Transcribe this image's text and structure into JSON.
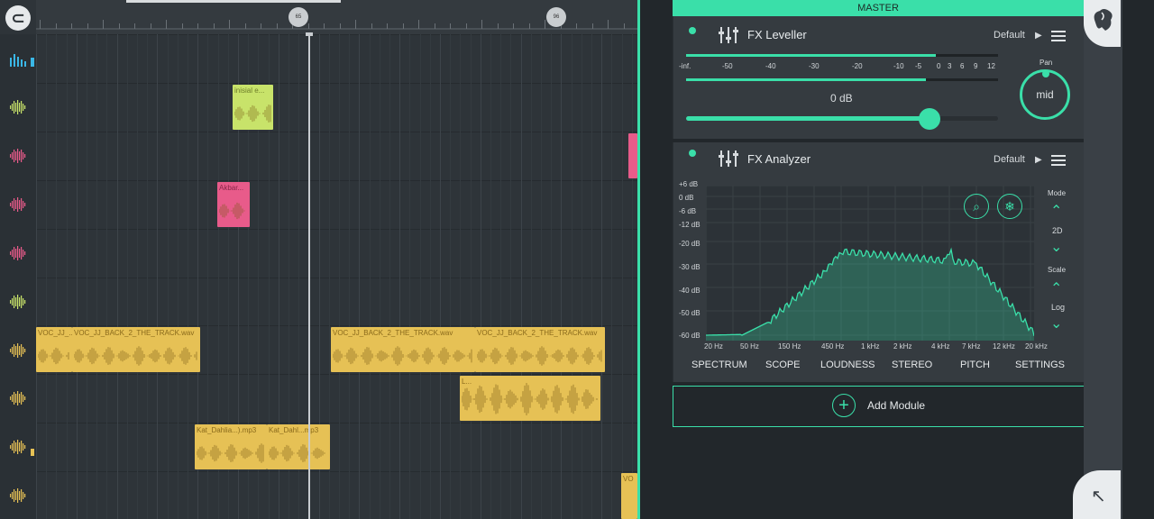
{
  "playlist": {
    "markers": [
      {
        "label": "65"
      },
      {
        "label": "96"
      }
    ],
    "clips": [
      {
        "label": "inisial e...",
        "color": "#c8e36a"
      },
      {
        "label": "",
        "color": "#e85b8a"
      },
      {
        "label": "Akbar...",
        "color": "#e85b8a"
      },
      {
        "label": "VOC_JJ_...",
        "color": "#e6c155"
      },
      {
        "label": "VOC_JJ_BACK_2_THE_TRACK.wav",
        "color": "#e6c155"
      },
      {
        "label": "VOC_JJ_BACK_2_THE_TRACK.wav",
        "color": "#e6c155"
      },
      {
        "label": "VOC_JJ_BACK_2_THE_TRACK.wav",
        "color": "#e6c155"
      },
      {
        "label": "L...",
        "color": "#e6c155"
      },
      {
        "label": "Kat_Dahlia...).mp3",
        "color": "#e6c155"
      },
      {
        "label": "Kat_Dahl...mp3",
        "color": "#e6c155"
      },
      {
        "label": "VO",
        "color": "#e6c155"
      }
    ]
  },
  "mixer": {
    "master_title": "MASTER",
    "leveller": {
      "title": "FX Leveller",
      "preset": "Default",
      "scale": [
        "-inf.",
        "-50",
        "-40",
        "-30",
        "-20",
        "-10",
        "-5",
        "0",
        "3",
        "6",
        "9",
        "12"
      ],
      "level_label": "0 dB",
      "level_fraction": 0.78,
      "pan_label": "Pan",
      "pan_value": "mid"
    },
    "analyzer": {
      "title": "FX Analyzer",
      "preset": "Default",
      "db_labels": [
        "+6 dB",
        "0 dB",
        "-6 dB",
        "-12 dB",
        "-20 dB",
        "-30 dB",
        "-40 dB",
        "-50 dB",
        "-60 dB"
      ],
      "freq_labels": [
        "20 Hz",
        "50 Hz",
        "150 Hz",
        "450 Hz",
        "1 kHz",
        "2 kHz",
        "4 kHz",
        "7 kHz",
        "12 kHz",
        "20 kHz"
      ],
      "mode_label": "Mode",
      "mode_value": "2D",
      "scale_label": "Scale",
      "scale_value": "Log",
      "tabs": [
        "SPECTRUM",
        "SCOPE",
        "LOUDNESS",
        "STEREO",
        "PITCH",
        "SETTINGS"
      ]
    },
    "add_module": "Add Module"
  },
  "colors": {
    "accent": "#3adfa9",
    "clip_yellow": "#e6c155",
    "clip_pink": "#e85b8a",
    "clip_lime": "#c8e36a"
  }
}
